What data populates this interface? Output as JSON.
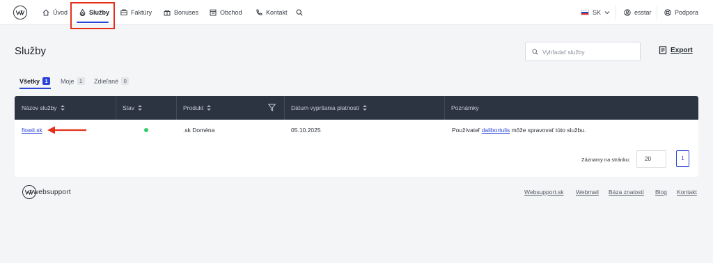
{
  "nav": {
    "items": [
      {
        "label": "Úvod",
        "icon": "home-icon"
      },
      {
        "label": "Služby",
        "icon": "flame-icon"
      },
      {
        "label": "Faktúry",
        "icon": "invoice-icon"
      },
      {
        "label": "Bonuses",
        "icon": "gift-icon"
      },
      {
        "label": "Obchod",
        "icon": "store-icon"
      },
      {
        "label": "Kontakt",
        "icon": "phone-icon"
      }
    ],
    "active_index": 1,
    "language": "SK",
    "username": "esstar",
    "support_label": "Podpora"
  },
  "page": {
    "title": "Služby",
    "search_placeholder": "Vyhľadať služby",
    "export_label": "Export"
  },
  "tabs": [
    {
      "label": "Všetky",
      "count": "1"
    },
    {
      "label": "Moje",
      "count": "1"
    },
    {
      "label": "Zdieľané",
      "count": "0"
    }
  ],
  "table": {
    "columns": [
      "Názov služby",
      "Stav",
      "Produkt",
      "Dátum vypršania platnosti",
      "Poznámky"
    ],
    "rows": [
      {
        "name": "flowii.sk",
        "status": "active",
        "product": ".sk Doména",
        "expiry": "05.10.2025",
        "note_prefix": "Používateľ",
        "note_user": "dalibortulis",
        "note_suffix": "môže spravovať túto službu."
      }
    ],
    "per_page_label": "Záznamy na stránku:",
    "per_page_value": "20",
    "current_page": "1"
  },
  "footer": {
    "logo_text": "websupport",
    "links": [
      "Websupport.sk",
      "Webmail",
      "Báza znalostí",
      "Blog",
      "Kontakt"
    ]
  },
  "colors": {
    "accent": "#2b44d8",
    "table_header": "#2c3441",
    "status_active": "#2fce6b",
    "highlight_red": "#e4301a"
  }
}
